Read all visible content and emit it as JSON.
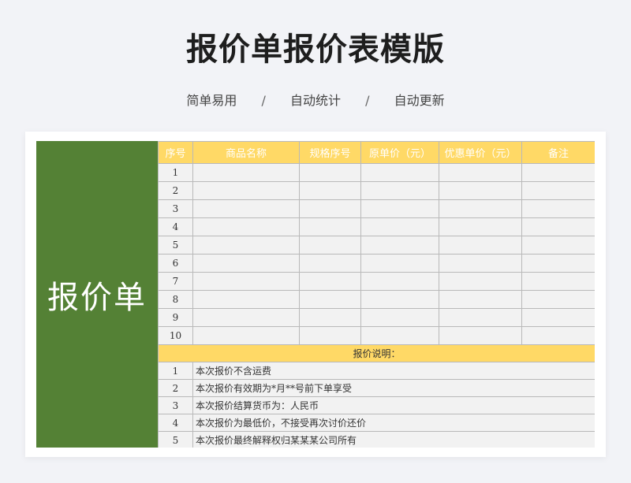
{
  "page": {
    "title": "报价单报价表模版",
    "tags": [
      "简单易用",
      "自动统计",
      "自动更新"
    ],
    "separator": "/"
  },
  "sheet": {
    "side_label": "报价单",
    "columns": [
      "序号",
      "商品名称",
      "规格序号",
      "原单价（元）",
      "优惠单价（元）",
      "备注"
    ],
    "rows": [
      "1",
      "2",
      "3",
      "4",
      "5",
      "6",
      "7",
      "8",
      "9",
      "10"
    ],
    "notes_title": "报价说明：",
    "notes": [
      {
        "num": "1",
        "text": "本次报价不含运费"
      },
      {
        "num": "2",
        "text": "本次报价有效期为*月**号前下单享受"
      },
      {
        "num": "3",
        "text": "本次报价结算货币为：人民币"
      },
      {
        "num": "4",
        "text": "本次报价为最低价，不接受再次讨价还价"
      },
      {
        "num": "5",
        "text": "本次报价最终解释权归某某某公司所有"
      }
    ]
  },
  "colors": {
    "header_yellow": "#ffd966",
    "side_green": "#548135",
    "cell_gray": "#f2f2f2",
    "background": "#f2f3f7"
  }
}
